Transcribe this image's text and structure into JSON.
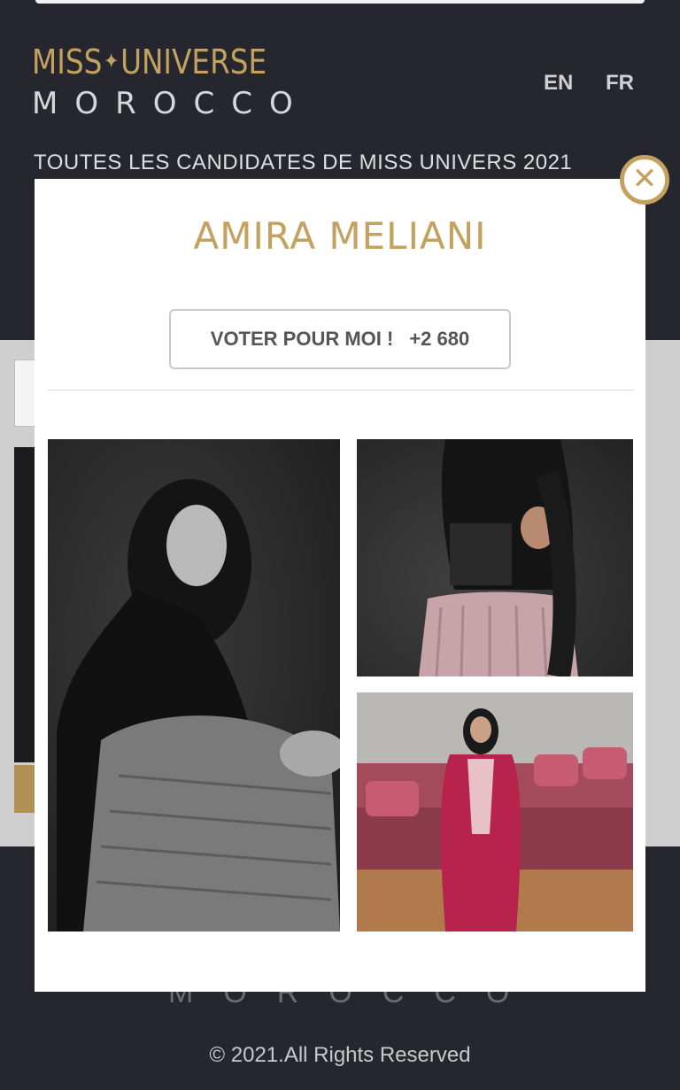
{
  "header": {
    "logo_line1_left": "MISS",
    "logo_star": "✦",
    "logo_line1_right": "UNIVERSE",
    "logo_line2": "MOROCCO",
    "lang_en": "EN",
    "lang_fr": "FR"
  },
  "page": {
    "candidates_heading": "TOUTES LES CANDIDATES DE MISS UNIVERS 2021"
  },
  "modal": {
    "close_symbol": "✕",
    "candidate_name": "AMIRA MELIANI",
    "vote_label": "VOTER POUR MOI !",
    "vote_count": "+2 680",
    "photos": [
      "photo-portrait-bw",
      "photo-lace-top",
      "photo-pink-caftan"
    ]
  },
  "footer": {
    "logo_text": "MOROCCO",
    "copyright": "© 2021.All Rights Reserved"
  },
  "colors": {
    "background": "#26262e",
    "gold": "#c3a15f",
    "modal": "#ffffff"
  }
}
